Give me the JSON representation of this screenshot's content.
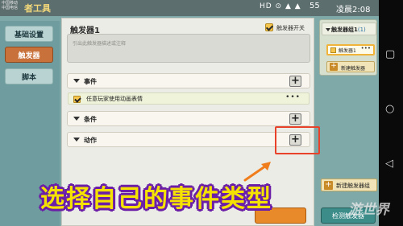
{
  "statusbar": {
    "carrier_line1": "中国移动",
    "carrier_line2": "中国电信",
    "app_title": "者工具",
    "signal_icons": "HD ⊙ ▲ ▲",
    "battery_level": "55",
    "time": "凌晨2:08"
  },
  "nav": {
    "items": [
      {
        "label": "基础设置",
        "active": false
      },
      {
        "label": "触发器",
        "active": true
      },
      {
        "label": "脚本",
        "active": false
      }
    ]
  },
  "panel": {
    "title": "触发器1",
    "switch_label": "触发器开关",
    "description_placeholder": "引出此触发器描述或注释",
    "sections": [
      {
        "label": "事件"
      },
      {
        "label": "条件"
      },
      {
        "label": "动作"
      }
    ],
    "event_row": {
      "label": "任意玩家使用动画表情",
      "more": "•••"
    },
    "plus_symbol": "+"
  },
  "right_panel": {
    "group_label": "触发器组1",
    "group_count": "(1)",
    "trigger_label": "触发器1",
    "trigger_more": "•••",
    "new_trigger_label": "新建触发器",
    "new_group_label": "新建触发器组",
    "plus_symbol": "+"
  },
  "bottom": {
    "teal_button_label": "检测触发器"
  },
  "overlay": {
    "caption": "选择自己的事件类型",
    "watermark": "游世界"
  },
  "colors": {
    "active_tab": "#c9713a",
    "highlight_border": "#e8432a",
    "caption_text": "#f6e200",
    "caption_outline": "#6b1fa8"
  }
}
